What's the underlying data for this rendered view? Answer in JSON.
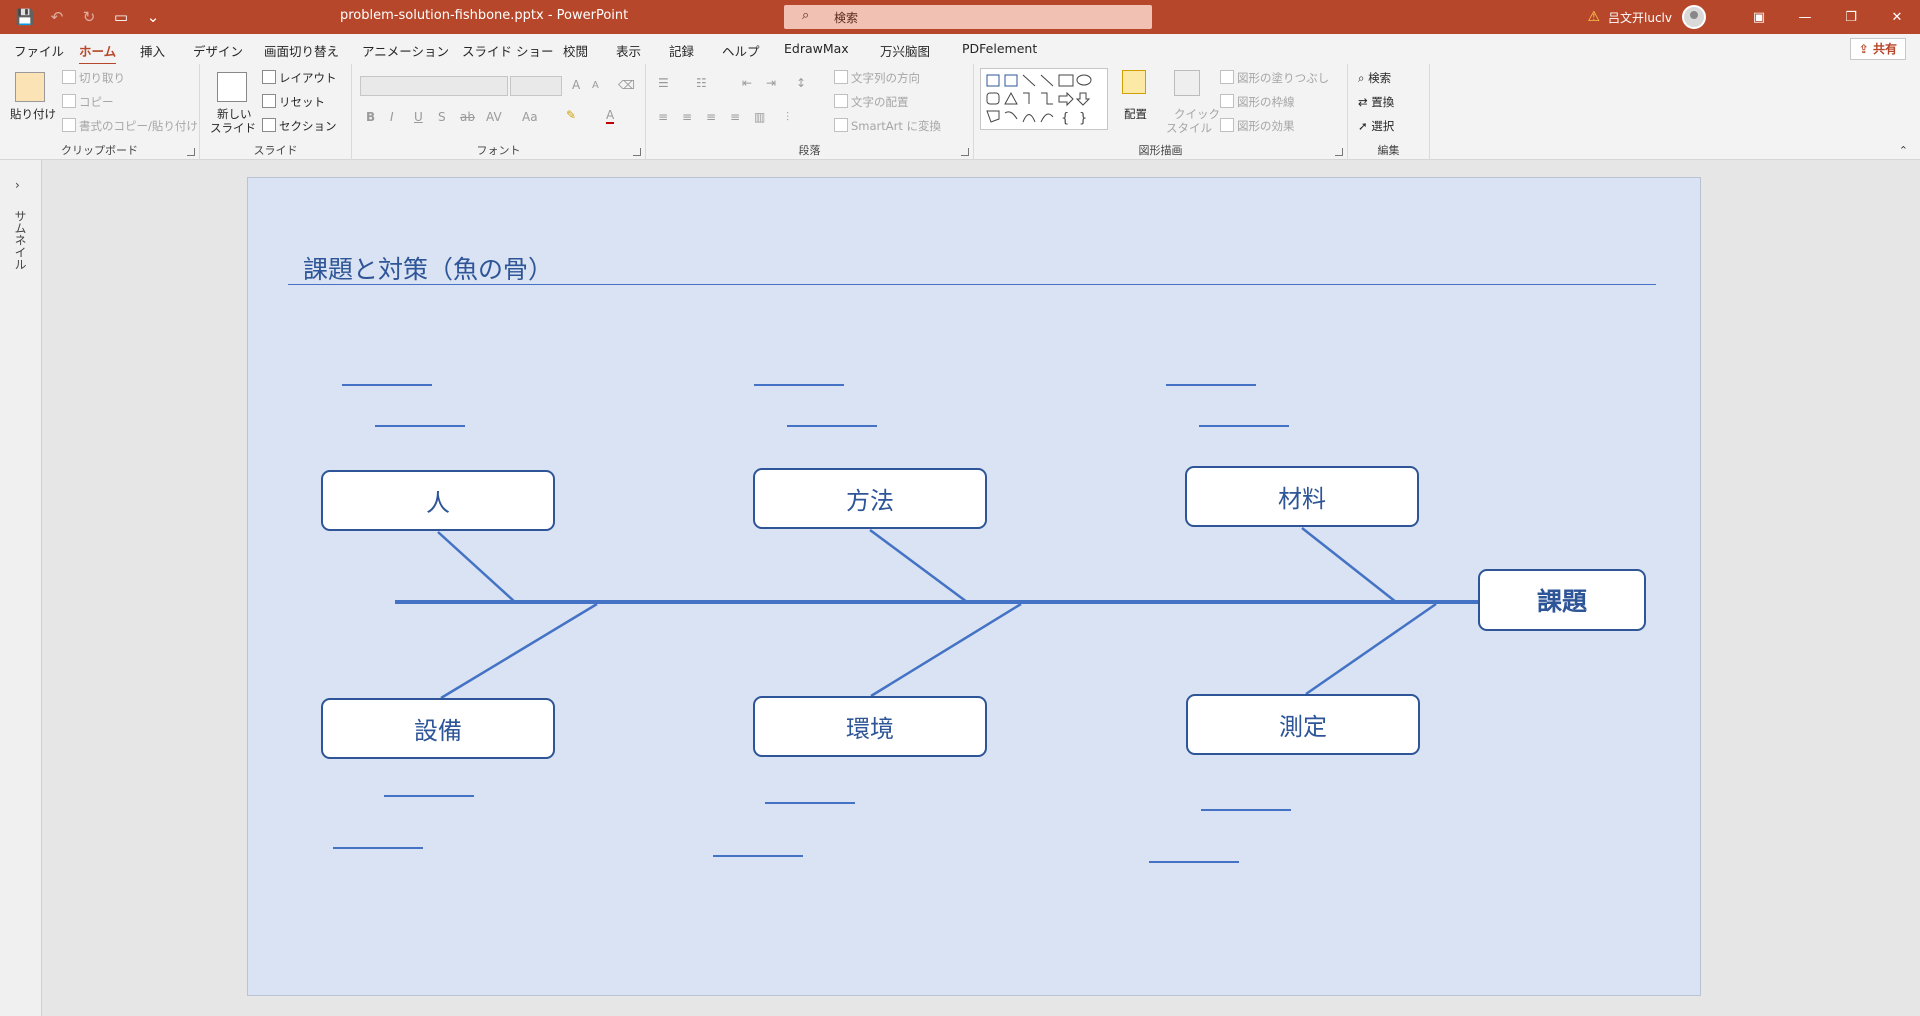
{
  "titlebar": {
    "doc_title": "problem-solution-fishbone.pptx  -  PowerPoint",
    "search_placeholder": "検索",
    "user_name": "吕文开luclv",
    "minimize": "—",
    "restore": "❐",
    "close": "✕"
  },
  "tabs": [
    "ファイル",
    "ホーム",
    "挿入",
    "デザイン",
    "画面切り替え",
    "アニメーション",
    "スライド ショー",
    "校閲",
    "表示",
    "記録",
    "ヘルプ",
    "EdrawMax",
    "万兴脑图",
    "PDFelement"
  ],
  "share_label": "共有",
  "ribbon": {
    "clipboard": {
      "label": "クリップボード",
      "paste": "貼り付け",
      "cut": "切り取り",
      "copy": "コピー",
      "format_painter": "書式のコピー/貼り付け"
    },
    "slides": {
      "label": "スライド",
      "new_slide_1": "新しい",
      "new_slide_2": "スライド",
      "layout": "レイアウト",
      "reset": "リセット",
      "section": "セクション"
    },
    "font": {
      "label": "フォント",
      "bold": "B",
      "italic": "I",
      "underline": "U",
      "shadow": "S",
      "strike": "ab",
      "spacing": "AV",
      "case": "Aa",
      "grow": "A",
      "shrink": "A",
      "color": "A"
    },
    "paragraph": {
      "label": "段落",
      "text_direction": "文字列の方向",
      "align_text": "文字の配置",
      "smartart": "SmartArt に変換"
    },
    "drawing": {
      "label": "図形描画",
      "arrange": "配置",
      "quick_styles_1": "クイック",
      "quick_styles_2": "スタイル",
      "shape_fill": "図形の塗りつぶし",
      "shape_outline": "図形の枠線",
      "shape_effects": "図形の効果"
    },
    "editing": {
      "label": "編集",
      "find": "検索",
      "replace": "置換",
      "select": "選択"
    }
  },
  "thumbnail_pane_label": "サムネイル",
  "slide": {
    "title": "課題と対策（魚の骨）",
    "head": "課題",
    "categories": {
      "top": [
        "人",
        "方法",
        "材料"
      ],
      "bottom": [
        "設備",
        "環境",
        "測定"
      ]
    }
  },
  "colors": {
    "accent": "#b7472a",
    "slide_bg": "#d9e3f3",
    "line": "#4472c4",
    "text": "#2e5597"
  }
}
